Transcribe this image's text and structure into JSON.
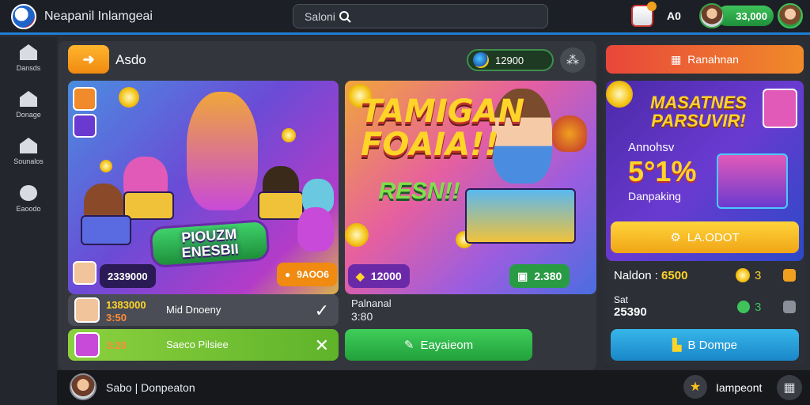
{
  "header": {
    "app_title": "Neapanil Inlamgeai",
    "search_text": "Saloni",
    "gift_count": "A0",
    "balance": "33,000"
  },
  "sidebar": {
    "items": [
      {
        "label": "Dansds",
        "icon": "home-icon"
      },
      {
        "label": "Donage",
        "icon": "home-icon"
      },
      {
        "label": "Sounalos",
        "icon": "home-icon"
      },
      {
        "label": "Eaoodo",
        "icon": "chat-icon"
      }
    ]
  },
  "main": {
    "section_title": "Asdo",
    "coins": "12900",
    "card1": {
      "title": "PIOUZM ENESBII",
      "player_score": "2339000",
      "prize": "9AOO6"
    },
    "card2": {
      "title": "TAMIGAN FOAIA!!",
      "subtitle": "RESN!!",
      "prize_left": "12000",
      "prize_right": "2.380"
    },
    "rows": [
      {
        "score": "1383000",
        "sub": "3:50",
        "name": "Mid Dnoeny",
        "action": "✓"
      },
      {
        "score": "3:20",
        "sub": "",
        "name": "Saeco Pilsiee",
        "action": "✕"
      }
    ],
    "under_card2": {
      "label": "Palnanal",
      "value": "3:80"
    },
    "explore_label": "Eayaieom"
  },
  "right": {
    "promo_btn": "Ranahnan",
    "promo_title": "MASATNES PARSUVIR!",
    "promo_sub": "Annohsv",
    "promo_pct": "5°1%",
    "promo_sub2": "Danpaking",
    "claim_label": "LA.ODOT",
    "stat1_label": "Naldon :",
    "stat1_value": "6500",
    "stat1_extra": "3",
    "stat2_label": "Sat",
    "stat2_value": "25390",
    "stat2_extra": "3",
    "dompe_label": "B Dompe"
  },
  "bottom": {
    "player_text": "Sabo | Donpeaton",
    "right_text": "Iampeont"
  },
  "colors": {
    "accent_blue": "#1e7fd6",
    "green": "#3fc25a",
    "orange": "#f08a10",
    "yellow": "#ffd43a"
  }
}
